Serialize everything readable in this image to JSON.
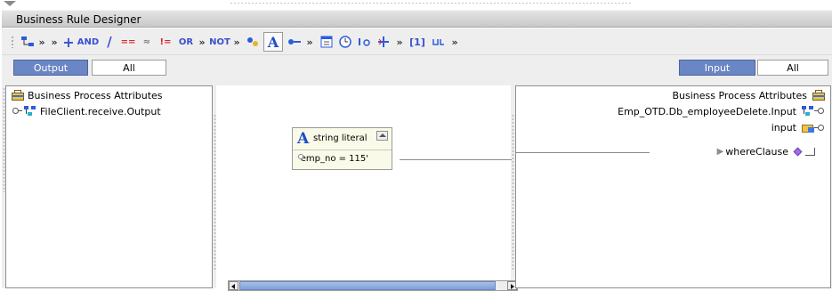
{
  "window": {
    "title": "Business Rule Designer"
  },
  "toolbar": {
    "items": [
      {
        "icon": "method-palette-icon"
      },
      {
        "label": "»",
        "icon": "chevron-more-icon"
      },
      {
        "label": "»",
        "icon": "chevron-more-icon"
      },
      {
        "label": "+",
        "icon": "add-icon"
      },
      {
        "label": "AND",
        "icon": "and-icon"
      },
      {
        "label": "/",
        "icon": "divide-icon"
      },
      {
        "label": "==",
        "icon": "equals-icon"
      },
      {
        "label": "≈",
        "icon": "approx-icon"
      },
      {
        "label": "!=",
        "icon": "not-equals-icon"
      },
      {
        "label": "OR",
        "icon": "or-icon"
      },
      {
        "label": "»",
        "icon": "chevron-more-icon"
      },
      {
        "label": "NOT",
        "icon": "not-icon"
      },
      {
        "label": "»",
        "icon": "chevron-more-icon"
      },
      {
        "icon": "number-method-icon"
      },
      {
        "label": "A",
        "icon": "string-literal-icon"
      },
      {
        "icon": "boolean-method-icon"
      },
      {
        "label": "»",
        "icon": "chevron-more-icon"
      },
      {
        "icon": "calendar-icon"
      },
      {
        "icon": "clock-icon"
      },
      {
        "icon": "io-icon"
      },
      {
        "icon": "operator-icon"
      },
      {
        "label": "»",
        "icon": "chevron-more-icon"
      },
      {
        "label": "[1]",
        "icon": "array-index-icon"
      },
      {
        "icon": "cast-icon"
      },
      {
        "label": "»",
        "icon": "chevron-more-icon"
      }
    ]
  },
  "left_tabs": {
    "selected": "Output",
    "other": "All"
  },
  "right_tabs": {
    "selected": "Input",
    "other": "All"
  },
  "left_tree": {
    "root": "Business Process Attributes",
    "child": "FileClient.receive.Output"
  },
  "right_tree": {
    "root": "Business Process Attributes",
    "child": "Emp_OTD.Db_employeeDelete.Input",
    "grandchild": "input",
    "leaf": "whereClause"
  },
  "literal": {
    "title": "string literal",
    "value": "'emp_no = 115'"
  },
  "colors": {
    "tab_selected_bg": "#6b86c4",
    "toolbar_blue": "#3a4fd0",
    "literal_icon": "#1d4ec7"
  }
}
